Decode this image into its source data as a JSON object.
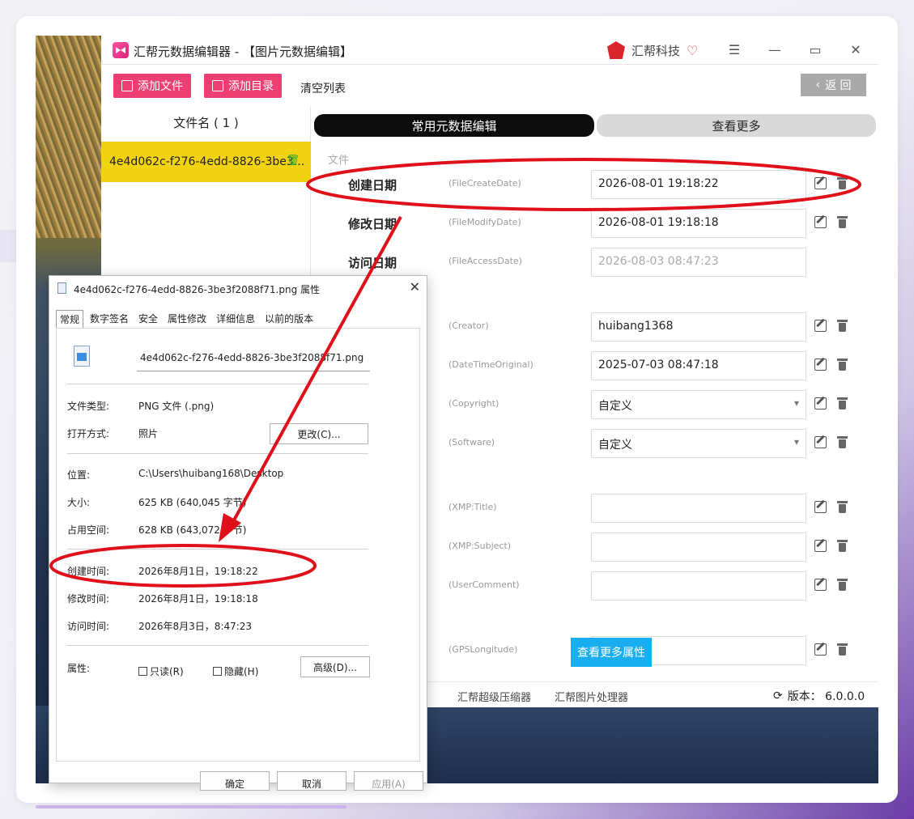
{
  "app": {
    "title": "汇帮元数据编辑器 - 【图片元数据编辑】",
    "brand": "汇帮科技",
    "buttons": {
      "add_file": "添加文件",
      "add_dir": "添加目录",
      "clear_list": "清空列表",
      "back": "返 回"
    },
    "file_list_header": "文件名 ( 1 )",
    "files": [
      {
        "name": "4e4d062c-f276-4edd-8826-3be3..."
      }
    ],
    "tabs": {
      "common": "常用元数据编辑",
      "more": "查看更多"
    },
    "section_file": "文件",
    "fields": [
      {
        "label": "创建日期",
        "key": "(FileCreateDate)",
        "value": "2026-08-01 19:18:22",
        "readonly": false,
        "type": "text"
      },
      {
        "label": "修改日期",
        "key": "(FileModifyDate)",
        "value": "2026-08-01 19:18:18",
        "readonly": false,
        "type": "text"
      },
      {
        "label": "访问日期",
        "key": "(FileAccessDate)",
        "value": "2026-08-03 08:47:23",
        "readonly": true,
        "type": "text"
      },
      {
        "label": "",
        "key": "(Creator)",
        "value": "huibang1368",
        "readonly": false,
        "type": "text"
      },
      {
        "label": "",
        "key": "(DateTimeOriginal)",
        "value": "2025-07-03 08:47:18",
        "readonly": false,
        "type": "text"
      },
      {
        "label": "",
        "key": "(Copyright)",
        "value": "自定义",
        "readonly": false,
        "type": "select"
      },
      {
        "label": "",
        "key": "(Software)",
        "value": "自定义",
        "readonly": false,
        "type": "select"
      },
      {
        "label": "",
        "key": "(XMP:Title)",
        "value": "",
        "readonly": false,
        "type": "text"
      },
      {
        "label": "",
        "key": "(XMP:Subject)",
        "value": "",
        "readonly": false,
        "type": "text"
      },
      {
        "label": "",
        "key": "(UserComment)",
        "value": "",
        "readonly": false,
        "type": "text"
      },
      {
        "label": "",
        "key": "(GPSLongitude)",
        "value": "",
        "readonly": false,
        "type": "text"
      }
    ],
    "more_attributes_button": "查看更多属性",
    "status": {
      "compressor": "汇帮超级压缩器",
      "image_tool": "汇帮图片处理器",
      "version": "版本： 6.0.0.0"
    }
  },
  "dialog": {
    "title": "4e4d062c-f276-4edd-8826-3be3f2088f71.png 属性",
    "tabs": [
      "常规",
      "数字签名",
      "安全",
      "属性修改",
      "详细信息",
      "以前的版本"
    ],
    "file_name": "4e4d062c-f276-4edd-8826-3be3f2088f71.png",
    "props": {
      "type_label": "文件类型:",
      "type_value": "PNG 文件 (.png)",
      "open_label": "打开方式:",
      "open_value": "照片",
      "change_btn": "更改(C)...",
      "location_label": "位置:",
      "location_value": "C:\\Users\\huibang168\\Desktop",
      "size_label": "大小:",
      "size_value": "625 KB (640,045 字节)",
      "disk_label": "占用空间:",
      "disk_value": "628 KB (643,072 字节)",
      "created_label": "创建时间:",
      "created_value": "2026年8月1日，19:18:22",
      "modified_label": "修改时间:",
      "modified_value": "2026年8月1日，19:18:18",
      "accessed_label": "访问时间:",
      "accessed_value": "2026年8月3日，8:47:23",
      "attr_label": "属性:",
      "readonly": "只读(R)",
      "hidden": "隐藏(H)",
      "advanced": "高级(D)..."
    },
    "footer": {
      "ok": "确定",
      "cancel": "取消",
      "apply": "应用(A)"
    }
  },
  "colors": {
    "accent": "#ee3f74",
    "highlight": "#f2d312",
    "annotation": "#e0101a",
    "info": "#19aef0"
  }
}
